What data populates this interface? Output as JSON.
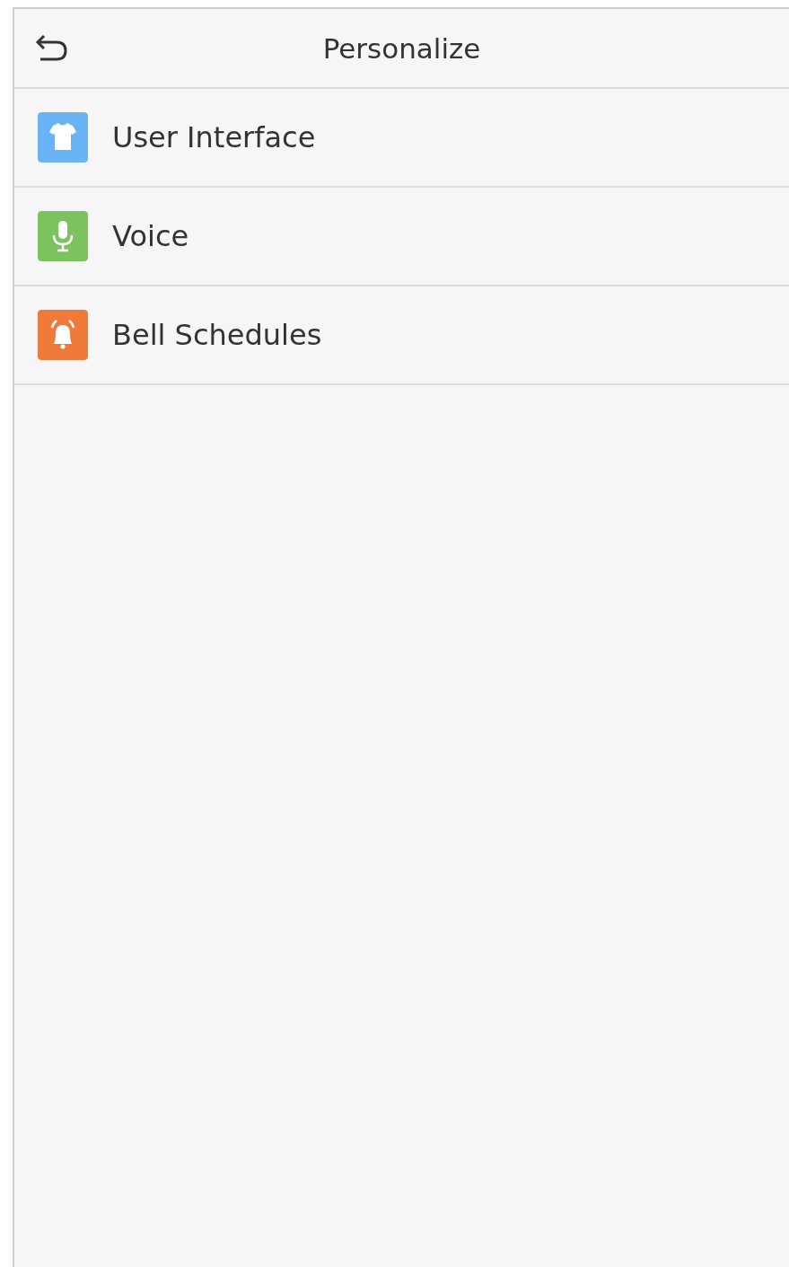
{
  "header": {
    "title": "Personalize"
  },
  "items": [
    {
      "label": "User Interface",
      "kind": "shirt",
      "color": "#6ab4f5"
    },
    {
      "label": "Voice",
      "kind": "mic",
      "color": "#7cc35e"
    },
    {
      "label": "Bell Schedules",
      "kind": "bell",
      "color": "#ef7a3a"
    }
  ]
}
